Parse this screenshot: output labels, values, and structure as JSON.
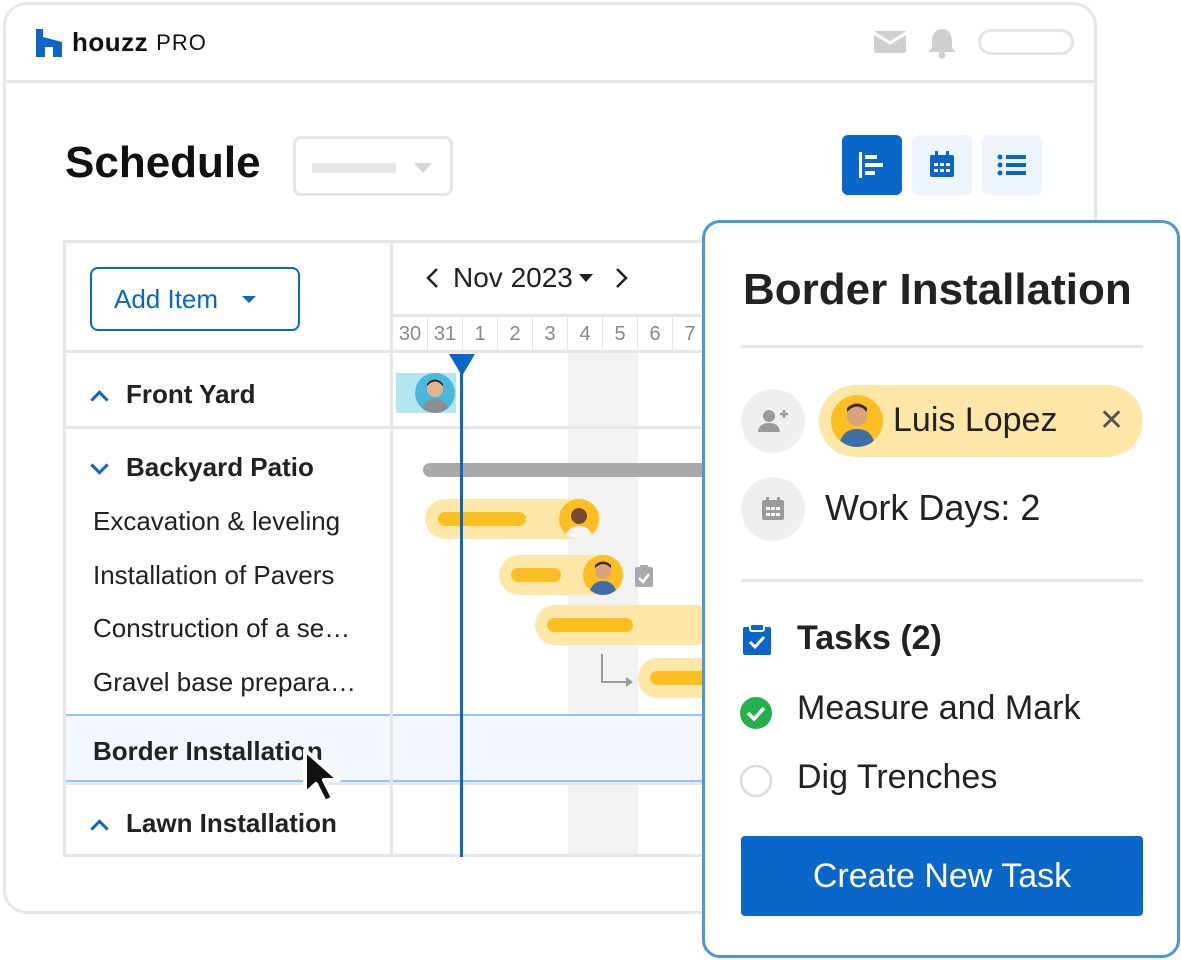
{
  "brand": {
    "name": "houzz",
    "suffix": "PRO",
    "color": "#0a66c8"
  },
  "page": {
    "title": "Schedule"
  },
  "views": [
    {
      "icon": "gantt-view-icon",
      "active": true
    },
    {
      "icon": "calendar-view-icon",
      "active": false
    },
    {
      "icon": "list-view-icon",
      "active": false
    }
  ],
  "toolbar": {
    "add_item_label": "Add Item"
  },
  "timeline": {
    "month_label": "Nov 2023",
    "days": [
      "30",
      "31",
      "1",
      "2",
      "3",
      "4",
      "5",
      "6",
      "7"
    ]
  },
  "rows": {
    "front_yard": "Front Yard",
    "backyard_patio": "Backyard Patio",
    "excavation": "Excavation & leveling",
    "pavers": "Installation of Pavers",
    "construction": "Construction of a se…",
    "gravel": "Gravel base prepara…",
    "border": "Border Installation",
    "lawn": "Lawn Installation"
  },
  "detail": {
    "title": "Border Installation",
    "assignee": "Luis Lopez",
    "work_days": "Work Days: 2",
    "tasks_header": "Tasks (2)",
    "tasks": [
      {
        "label": "Measure and Mark",
        "done": true
      },
      {
        "label": "Dig Trenches",
        "done": false
      }
    ],
    "create_button": "Create New Task"
  },
  "colors": {
    "accent": "#0a66c8",
    "bar_light": "#fde7a8",
    "bar_dark": "#fbbf24",
    "done_green": "#22b14c"
  }
}
